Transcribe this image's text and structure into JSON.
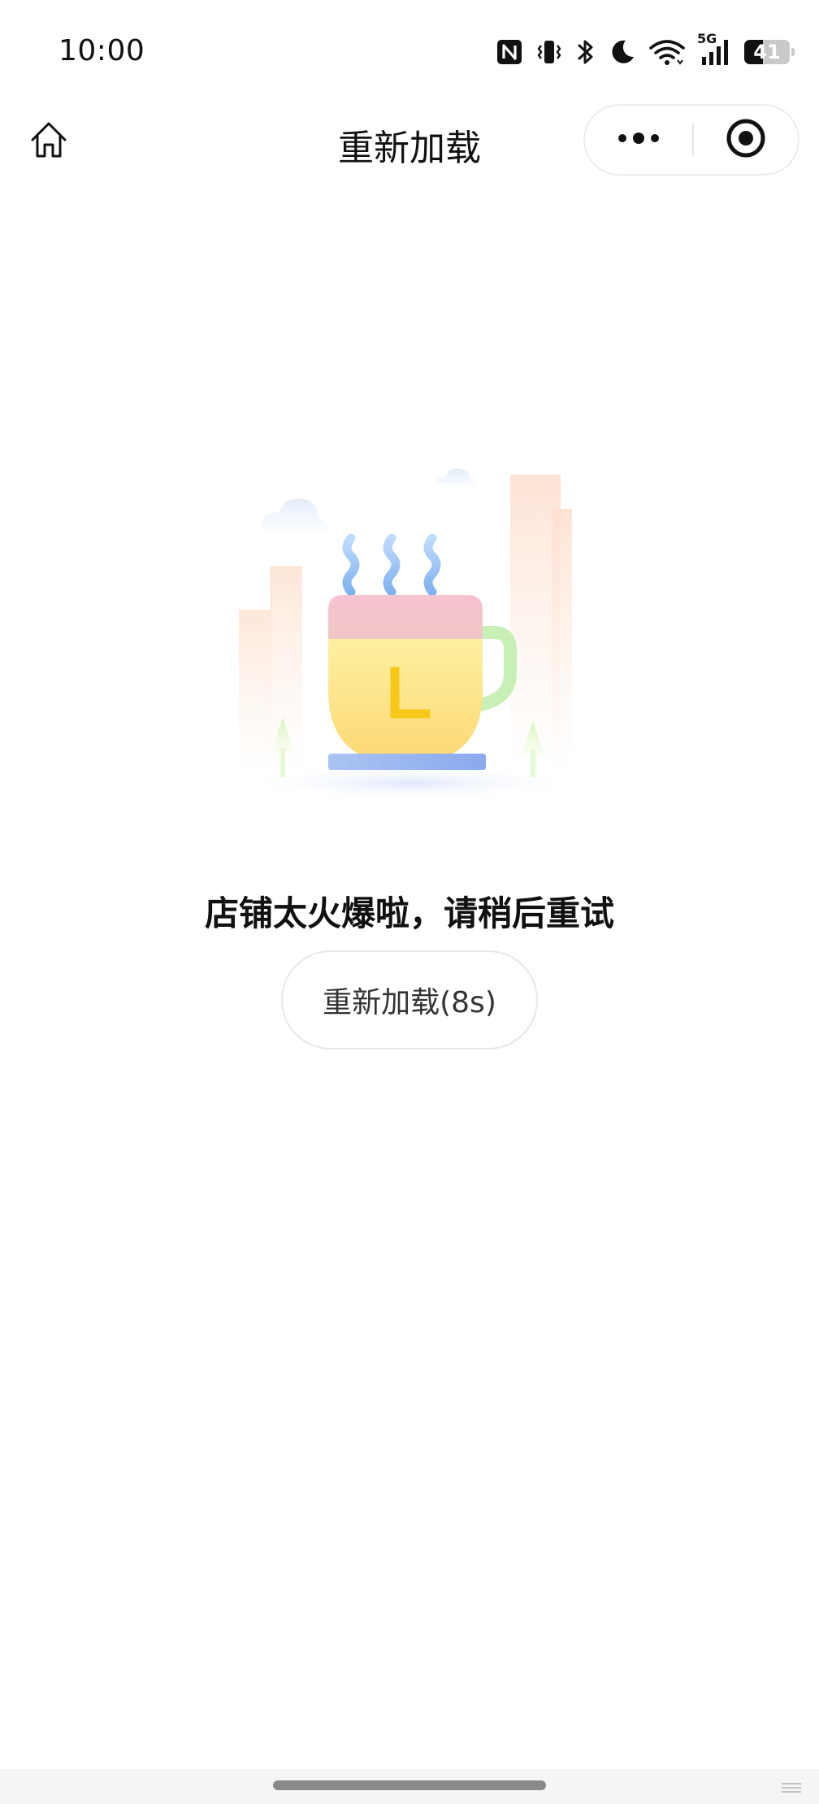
{
  "status_bar": {
    "time": "10:00",
    "network_label": "5G",
    "battery_level": "41",
    "battery_fraction": 0.41,
    "icons": [
      "nfc-icon",
      "vibrate-icon",
      "bluetooth-icon",
      "do-not-disturb-icon",
      "wifi-icon",
      "cellular-signal-icon",
      "battery-icon"
    ]
  },
  "nav": {
    "title": "重新加载",
    "home_icon": "home-icon",
    "more_icon": "more-dots-icon",
    "close_icon": "target-close-icon"
  },
  "main": {
    "illustration": "busy-coffee-cup-illustration",
    "message": "店铺太火爆啦，请稍后重试",
    "reload_button_label": "重新加载(8s)"
  },
  "colors": {
    "text_primary": "#111111",
    "button_text": "#333333",
    "button_border": "#e8e8e8",
    "cup_body": "#fde68a",
    "cup_rim": "#f4c2cc",
    "steam": "#93c5fd",
    "clock_hand": "#facc15",
    "handle": "#bbf7d0",
    "saucer": "#93b4f2"
  }
}
